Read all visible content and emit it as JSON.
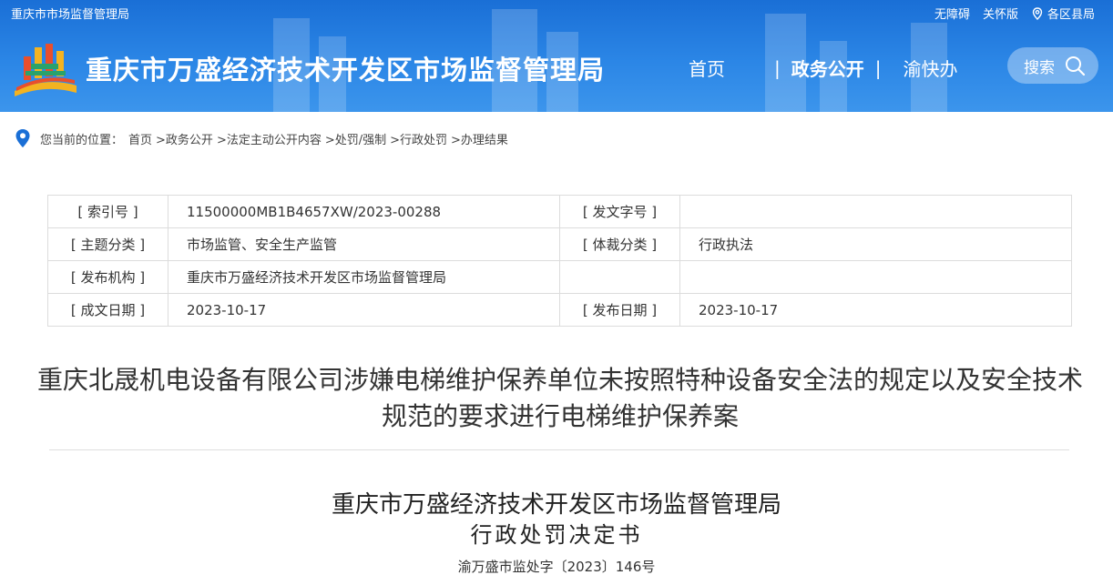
{
  "topbar": {
    "site_name": "重庆市市场监督管理局",
    "accessibility": "无障碍",
    "care_mode": "关怀版",
    "districts": "各区县局"
  },
  "header": {
    "title": "重庆市万盛经济技术开发区市场监督管理局",
    "nav": [
      "首页",
      "政务公开",
      "渝快办"
    ],
    "search_label": "搜索"
  },
  "breadcrumb": {
    "prefix": "您当前的位置：",
    "items": [
      "首页",
      ">政务公开",
      ">法定主动公开内容",
      ">处罚/强制",
      ">行政处罚",
      ">办理结果"
    ]
  },
  "meta": {
    "index_label": "[ 索引号 ]",
    "index_value": "11500000MB1B4657XW/2023-00288",
    "docno_label": "[ 发文字号 ]",
    "docno_value": "",
    "topic_label": "[ 主题分类 ]",
    "topic_value": "市场监管、安全生产监管",
    "genre_label": "[ 体裁分类 ]",
    "genre_value": "行政执法",
    "org_label": "[ 发布机构 ]",
    "org_value": "重庆市万盛经济技术开发区市场监督管理局",
    "created_label": "[ 成文日期 ]",
    "created_value": "2023-10-17",
    "published_label": "[ 发布日期 ]",
    "published_value": "2023-10-17"
  },
  "article": {
    "title": "重庆北晟机电设备有限公司涉嫌电梯维护保养单位未按照特种设备安全法的规定以及安全技术规范的要求进行电梯维护保养案",
    "doc_org": "重庆市万盛经济技术开发区市场监督管理局",
    "doc_type": "行政处罚决定书",
    "doc_number": "渝万盛市监处字〔2023〕146号"
  }
}
